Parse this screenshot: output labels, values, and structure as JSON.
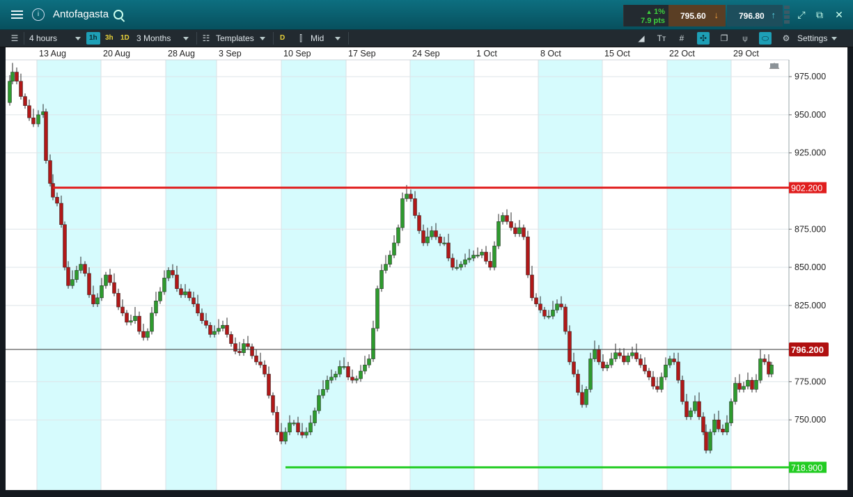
{
  "titlebar": {
    "title": "Antofagasta",
    "change_pct": "1%",
    "change_pts": "7.9 pts",
    "sell_price": "795.60",
    "buy_price": "796.80",
    "icons": [
      "menu-icon",
      "info-icon",
      "search-icon",
      "expand-icon",
      "popout-icon",
      "close-icon"
    ]
  },
  "toolbar": {
    "interval": "4 hours",
    "quick_1h": "1h",
    "quick_3h": "3h",
    "quick_1d": "1D",
    "range": "3 Months",
    "templates": "Templates",
    "d_label": "D",
    "price_mode": "Mid",
    "settings": "Settings"
  },
  "chart_data": {
    "type": "candlestick",
    "x_ticks": [
      "13 Aug",
      "20 Aug",
      "28 Aug",
      "3 Sep",
      "10 Sep",
      "17 Sep",
      "24 Sep",
      "1 Oct",
      "8 Oct",
      "15 Oct",
      "22 Oct",
      "29 Oct"
    ],
    "y_ticks": [
      "975.000",
      "950.000",
      "925.000",
      "875.000",
      "850.000",
      "825.000",
      "775.000",
      "750.000"
    ],
    "ylim": [
      704,
      986
    ],
    "current_price": 796.2,
    "current_label": "796.200",
    "resistance": {
      "value": 902.2,
      "label": "902.200",
      "color": "#e01e1e"
    },
    "support": {
      "value": 718.9,
      "label": "718.900",
      "color": "#22cc22"
    },
    "colors": {
      "up": "#2e9a2e",
      "down": "#b01818",
      "shade": "#d6fbfd"
    }
  }
}
